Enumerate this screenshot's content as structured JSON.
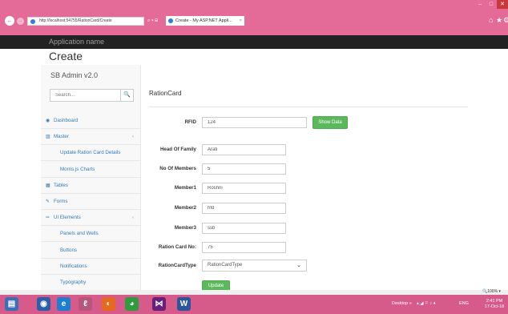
{
  "browser": {
    "url": "http://localhost:54755/RationCard/Create",
    "search_glyph": "⌕ ▾ ⊟",
    "tab_title": "Create - My ASP.NET Appli...",
    "tab_close": "×",
    "back_glyph": "←",
    "forward_glyph": "→",
    "window_controls": {
      "minimize": "–",
      "maximize": "□",
      "close": "✕"
    },
    "right_icons": {
      "home": "⌂",
      "favorites": "★",
      "settings": "⚙"
    }
  },
  "app": {
    "name": "Application name"
  },
  "page": {
    "title": "Create"
  },
  "sidebar": {
    "brand": "SB Admin v2.0",
    "search": {
      "placeholder": "Search...",
      "icon": "search-icon",
      "glyph": "🔍"
    },
    "items": [
      {
        "label": "Dashboard",
        "icon": "dashboard-icon",
        "glyph": "◉",
        "sub": false
      },
      {
        "label": "Master",
        "icon": "bar-chart-icon",
        "glyph": "▥",
        "sub": false,
        "caret": "‹"
      },
      {
        "label": "Update Ration Card Details",
        "sub": true
      },
      {
        "label": "Morris.js Charts",
        "sub": true
      },
      {
        "label": "Tables",
        "icon": "table-icon",
        "glyph": "▦",
        "sub": false
      },
      {
        "label": "Forms",
        "icon": "edit-icon",
        "glyph": "✎",
        "sub": false
      },
      {
        "label": "UI Elements",
        "icon": "wrench-icon",
        "glyph": "✑",
        "sub": false,
        "caret": "‹"
      },
      {
        "label": "Panels and Wells",
        "sub": true
      },
      {
        "label": "Buttons",
        "sub": true
      },
      {
        "label": "Notifications",
        "sub": true
      },
      {
        "label": "Typography",
        "sub": true
      }
    ]
  },
  "panel": {
    "title": "RationCard",
    "fields": {
      "rfid": {
        "label": "RFID",
        "value": "124"
      },
      "head_of_family": {
        "label": "Head Of Family",
        "value": "Arati"
      },
      "no_of_members": {
        "label": "No Of Members",
        "value": "5"
      },
      "member1": {
        "label": "Member1",
        "value": "Roshni"
      },
      "member2": {
        "label": "Member2",
        "value": "hfd"
      },
      "member3": {
        "label": "Member3",
        "value": "ssb"
      },
      "ration_card_no": {
        "label": "Ration Card No:",
        "value": "75"
      },
      "ration_card_type": {
        "label": "RationCardType",
        "value": "RationCardType",
        "caret": "⌄"
      }
    },
    "show_data_button": "Show Data",
    "update_button": "Update"
  },
  "status": {
    "zoom": "🔍100% ▾"
  },
  "taskbar": {
    "apps": [
      {
        "icon": "file-explorer-icon",
        "glyph": "▤",
        "color": "#3b6fb6"
      },
      {
        "icon": "media-player-icon",
        "glyph": "◉",
        "color": "#2d5fa8"
      },
      {
        "icon": "internet-explorer-icon",
        "glyph": "e",
        "color": "#1e7fd0"
      },
      {
        "icon": "app-icon",
        "glyph": "ℓ",
        "color": "#b5567d"
      },
      {
        "icon": "firefox-icon",
        "glyph": "◐",
        "color": "#e66a1e"
      },
      {
        "icon": "chrome-icon",
        "glyph": "◕",
        "color": "#2e9c3e"
      },
      {
        "icon": "visual-studio-icon",
        "glyph": "⋈",
        "color": "#68217a"
      },
      {
        "icon": "word-icon",
        "glyph": "W",
        "color": "#2b579a"
      }
    ],
    "desktop": "Desktop »",
    "tray_icons": "▴ ◢ ⚐ ♪ ♦",
    "language": "ENG",
    "time": "2:41 PM",
    "date": "17-Oct-18"
  }
}
